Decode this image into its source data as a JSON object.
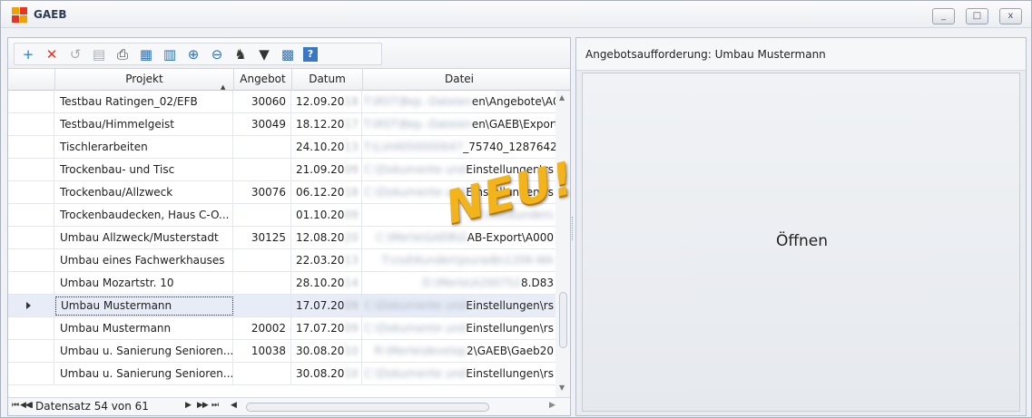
{
  "window": {
    "title": "GAEB",
    "controls": {
      "minimize": "_",
      "maximize": "□",
      "close": "x"
    }
  },
  "toolbar": {
    "buttons": [
      {
        "name": "add-button",
        "glyph": "+",
        "color": "#1f7fd1"
      },
      {
        "name": "delete-button",
        "glyph": "✕",
        "color": "#e2332b"
      },
      {
        "name": "undo-button",
        "glyph": "↺",
        "color": "#a9adb4"
      },
      {
        "name": "save-button",
        "glyph": "▤",
        "color": "#a9adb4"
      },
      {
        "name": "print-button",
        "glyph": "⎙",
        "color": "#333333"
      },
      {
        "name": "print-preview-button",
        "glyph": "▦",
        "color": "#2f6fb3"
      },
      {
        "name": "layout-button",
        "glyph": "▥",
        "color": "#2f6fb3"
      },
      {
        "name": "zoom-in-button",
        "glyph": "⊕",
        "color": "#2f6fb3"
      },
      {
        "name": "zoom-out-button",
        "glyph": "⊖",
        "color": "#2f6fb3"
      },
      {
        "name": "find-button",
        "glyph": "♞",
        "color": "#333333"
      },
      {
        "name": "filter-button",
        "glyph": "▼",
        "color": "#333333"
      },
      {
        "name": "columns-button",
        "glyph": "▩",
        "color": "#2f6fb3"
      },
      {
        "name": "help-button",
        "glyph": "?",
        "color": "#2f6fb3"
      }
    ]
  },
  "grid": {
    "columns": {
      "project": "Projekt",
      "offer": "Angebot",
      "date": "Datum",
      "file": "Datei"
    },
    "rows": [
      {
        "project": "Testbau Ratingen_02/EFB",
        "offer": "30060",
        "date": "12.09.20",
        "date_blur": "18",
        "file_blur": "T:\\RST\\Bep.-Dateien",
        "file": "en\\Angebote\\A0"
      },
      {
        "project": "Testbau/Himmelgeist",
        "offer": "30049",
        "date": "18.12.20",
        "date_blur": "17",
        "file_blur": "T:\\RST\\Bep.-Dateien",
        "file": "en\\GAEB\\Export'"
      },
      {
        "project": "Tischlerarbeiten",
        "offer": "",
        "date": "24.10.20",
        "date_blur": "13",
        "file_blur": "T:\\L\\H4050000047",
        "file": "_75740_1287642"
      },
      {
        "project": "Trockenbau- und Tisc",
        "offer": "",
        "date": "21.09.20",
        "date_blur": "09",
        "file_blur": "C:\\Dokumente und",
        "file": "Einstellungen\\rs"
      },
      {
        "project": "Trockenbau/Allzweck",
        "offer": "30076",
        "date": "06.12.20",
        "date_blur": "18",
        "file_blur": "C:\\Dokumente und",
        "file": "Einstellungen\\rs"
      },
      {
        "project": "Trockenbaudecken, Haus C-O...",
        "offer": "",
        "date": "01.10.20",
        "date_blur": "09",
        "file_blur": "T:\\rsd\\Kunden\\",
        "file": ""
      },
      {
        "project": "Umbau Allzweck/Musterstadt",
        "offer": "30125",
        "date": "12.08.20",
        "date_blur": "20",
        "file_blur": "C:\\Merle\\GAEB\\G",
        "file": "AB-Export\\A000"
      },
      {
        "project": "Umbau eines Fachwerkhauses",
        "offer": "",
        "date": "22.03.20",
        "date_blur": "13",
        "file_blur": "T:\\rsd\\Kunden\\jouradb\\1206-WA",
        "file": ""
      },
      {
        "project": "Umbau Mozartstr. 10",
        "offer": "",
        "date": "28.10.20",
        "date_blur": "14",
        "file_blur": "D:\\Merle\\A200752",
        "file": "8.D83"
      },
      {
        "project": "Umbau Mustermann",
        "offer": "",
        "date": "17.07.20",
        "date_blur": "09",
        "file_blur": "C:\\Dokumente und",
        "file": "Einstellungen\\rs"
      },
      {
        "project": "Umbau Mustermann",
        "offer": "20002",
        "date": "17.07.20",
        "date_blur": "09",
        "file_blur": "C:\\Dokumente und",
        "file": "Einstellungen\\rs"
      },
      {
        "project": "Umbau u. Sanierung Senioren...",
        "offer": "10038",
        "date": "30.08.20",
        "date_blur": "10",
        "file_blur": "R:\\Merle\\develop",
        "file": "2\\GAEB\\Gaeb20"
      },
      {
        "project": "Umbau u. Sanierung Senioren...",
        "offer": "",
        "date": "30.08.20",
        "date_blur": "10",
        "file_blur": "C:\\Dokumente und",
        "file": "Einstellungen\\rs"
      }
    ],
    "current_row_index": 9
  },
  "navigator": {
    "first": "⏮",
    "prev_page": "◀◀",
    "prev": "◀",
    "record_text": "Datensatz 54 von 61",
    "next": "▶",
    "next_page": "▶▶",
    "last": "⏭",
    "append": "◀"
  },
  "right_panel": {
    "title": "Angebotsaufforderung: Umbau Mustermann",
    "open_label": "Öffnen"
  },
  "overlay": {
    "stamp": "NEU!"
  }
}
